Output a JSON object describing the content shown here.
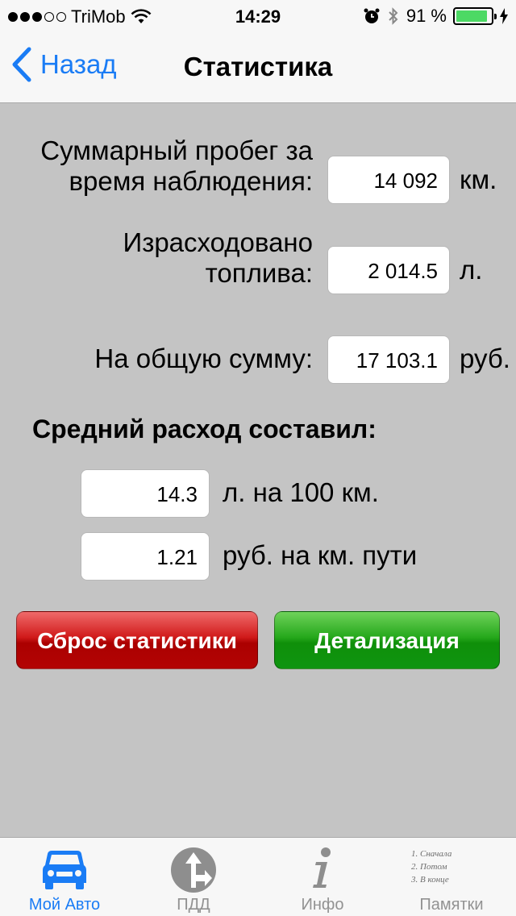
{
  "status": {
    "carrier": "TriMob",
    "time": "14:29",
    "battery": "91 %",
    "battery_level": 0.91,
    "signal_bars_filled": 3,
    "signal_bars_total": 5
  },
  "nav": {
    "back_label": "Назад",
    "title": "Статистика"
  },
  "stats": {
    "mileage": {
      "label_line1": "Суммарный пробег за",
      "label_line2": "время наблюдения:",
      "value": "14 092",
      "unit": "км."
    },
    "fuel": {
      "label_line1": "Израсходовано",
      "label_line2": "топлива:",
      "value": "2 014.5",
      "unit": "л."
    },
    "total": {
      "label": "На общую сумму:",
      "value": "17 103.1",
      "unit": "руб."
    }
  },
  "average": {
    "heading": "Средний расход составил:",
    "per100": {
      "value": "14.3",
      "unit": "л. на 100 км."
    },
    "perkm": {
      "value": "1.21",
      "unit": "руб. на км. пути"
    }
  },
  "buttons": {
    "reset": "Сброс статистики",
    "details": "Детализация"
  },
  "tabs": [
    {
      "label": "Мой Авто",
      "icon": "car-icon",
      "active": true
    },
    {
      "label": "ПДД",
      "icon": "road-sign-icon",
      "active": false
    },
    {
      "label": "Инфо",
      "icon": "info-icon",
      "active": false
    },
    {
      "label": "Памятки",
      "icon": "notes-icon",
      "active": false,
      "notes": [
        "1. Сначала",
        "2. Потом",
        "3. В конце"
      ]
    }
  ],
  "colors": {
    "accent": "#1a7cf5",
    "reset_button": "#c40f0f",
    "details_button": "#1c9e16",
    "battery": "#4cd964",
    "background": "#c4c4c4"
  }
}
